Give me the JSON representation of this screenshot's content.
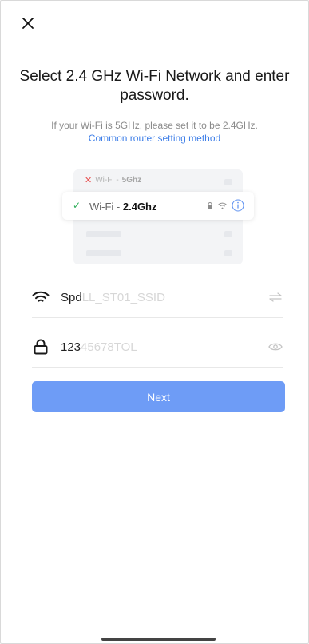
{
  "title": "Select 2.4 GHz Wi-Fi Network and enter password.",
  "subtitle": "If your Wi-Fi is 5GHz, please set it to be 2.4GHz.",
  "link_text": "Common router setting method",
  "illustration": {
    "row_5g_prefix": "Wi-Fi - ",
    "row_5g_band": "5Ghz",
    "row_24g_prefix": "Wi-Fi - ",
    "row_24g_band": "2.4Ghz"
  },
  "wifi_field": {
    "visible_value": "Spd",
    "faded_value": "LL_ST01_SSID",
    "icon": "wifi-icon",
    "trailing_icon": "switch-network-icon"
  },
  "password_field": {
    "visible_value": "123",
    "faded_value": "45678TOL",
    "icon": "lock-icon",
    "trailing_icon": "eye-icon"
  },
  "next_button": "Next",
  "colors": {
    "accent": "#6e9cf6",
    "link": "#3f7fe8",
    "success": "#2fae5a",
    "error": "#e84b4b"
  }
}
